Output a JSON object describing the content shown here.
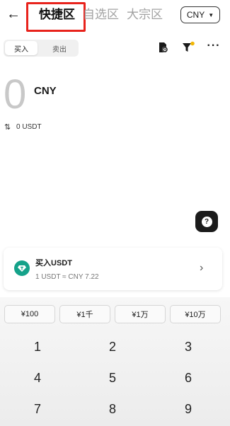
{
  "header": {
    "back_icon": "←",
    "tabs": [
      {
        "label": "快捷区",
        "active": true
      },
      {
        "label": "自选区",
        "active": false
      },
      {
        "label": "大宗区",
        "active": false
      }
    ],
    "currency": "CNY",
    "highlight_color": "#e8231c"
  },
  "toggle": {
    "buy": "买入",
    "sell": "卖出"
  },
  "amount": {
    "value": "0",
    "currency": "CNY",
    "swap_icon": "⇅",
    "usdt": "0 USDT"
  },
  "help_icon": "?",
  "card": {
    "title": "买入USDT",
    "rate": "1 USDT ≈ CNY 7.22",
    "icon": "usdt-diamond",
    "icon_color": "#15a28a"
  },
  "quick_amounts": [
    "¥100",
    "¥1千",
    "¥1万",
    "¥10万"
  ],
  "keypad": [
    "1",
    "2",
    "3",
    "4",
    "5",
    "6",
    "7",
    "8",
    "9"
  ]
}
